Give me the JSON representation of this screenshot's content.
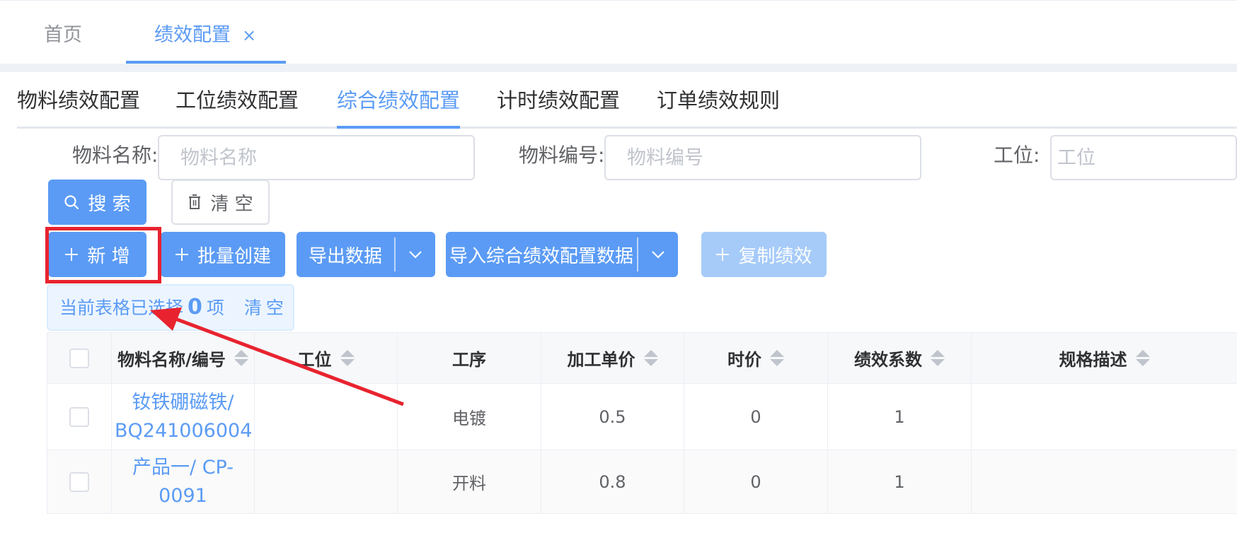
{
  "page_tabs": [
    {
      "label": "首页",
      "active": false
    },
    {
      "label": "绩效配置",
      "active": true,
      "close": "×"
    }
  ],
  "sub_tabs": [
    {
      "label": "物料绩效配置",
      "active": false
    },
    {
      "label": "工位绩效配置",
      "active": false
    },
    {
      "label": "综合绩效配置",
      "active": true
    },
    {
      "label": "计时绩效配置",
      "active": false
    },
    {
      "label": "订单绩效规则",
      "active": false
    }
  ],
  "search_form": {
    "material_name": {
      "label": "物料名称:",
      "placeholder": "物料名称",
      "value": ""
    },
    "material_code": {
      "label": "物料编号:",
      "placeholder": "物料编号",
      "value": ""
    },
    "station": {
      "label": "工位:",
      "placeholder": "工位",
      "value": ""
    },
    "search_button": "搜 索",
    "clear_button": "清 空"
  },
  "toolbar": {
    "add": "新 增",
    "batch_create": "批量创建",
    "export": "导出数据",
    "import": "导入综合绩效配置数据",
    "copy": "复制绩效"
  },
  "selection": {
    "prefix": "当前表格已选择",
    "count": "0",
    "suffix": "项",
    "clear": "清空"
  },
  "table": {
    "columns": [
      "物料名称/编号",
      "工位",
      "工序",
      "加工单价",
      "时价",
      "绩效系数",
      "规格描述"
    ],
    "rows": [
      {
        "material": "钕铁硼磁铁/ BQ241006004",
        "station": "",
        "process": "电镀",
        "unit_price": "0.5",
        "hourly_price": "0",
        "coefficient": "1",
        "spec": ""
      },
      {
        "material": "产品一/ CP-0091",
        "station": "",
        "process": "开料",
        "unit_price": "0.8",
        "hourly_price": "0",
        "coefficient": "1",
        "spec": ""
      }
    ]
  },
  "colors": {
    "primary": "#5b9bf5",
    "annotation": "#e8232f",
    "disabled": "#a6cbf9"
  },
  "icons": [
    "close-icon",
    "search-icon",
    "trash-icon",
    "plus-icon",
    "chevron-down-icon",
    "sort-icon",
    "annotation-arrow"
  ]
}
